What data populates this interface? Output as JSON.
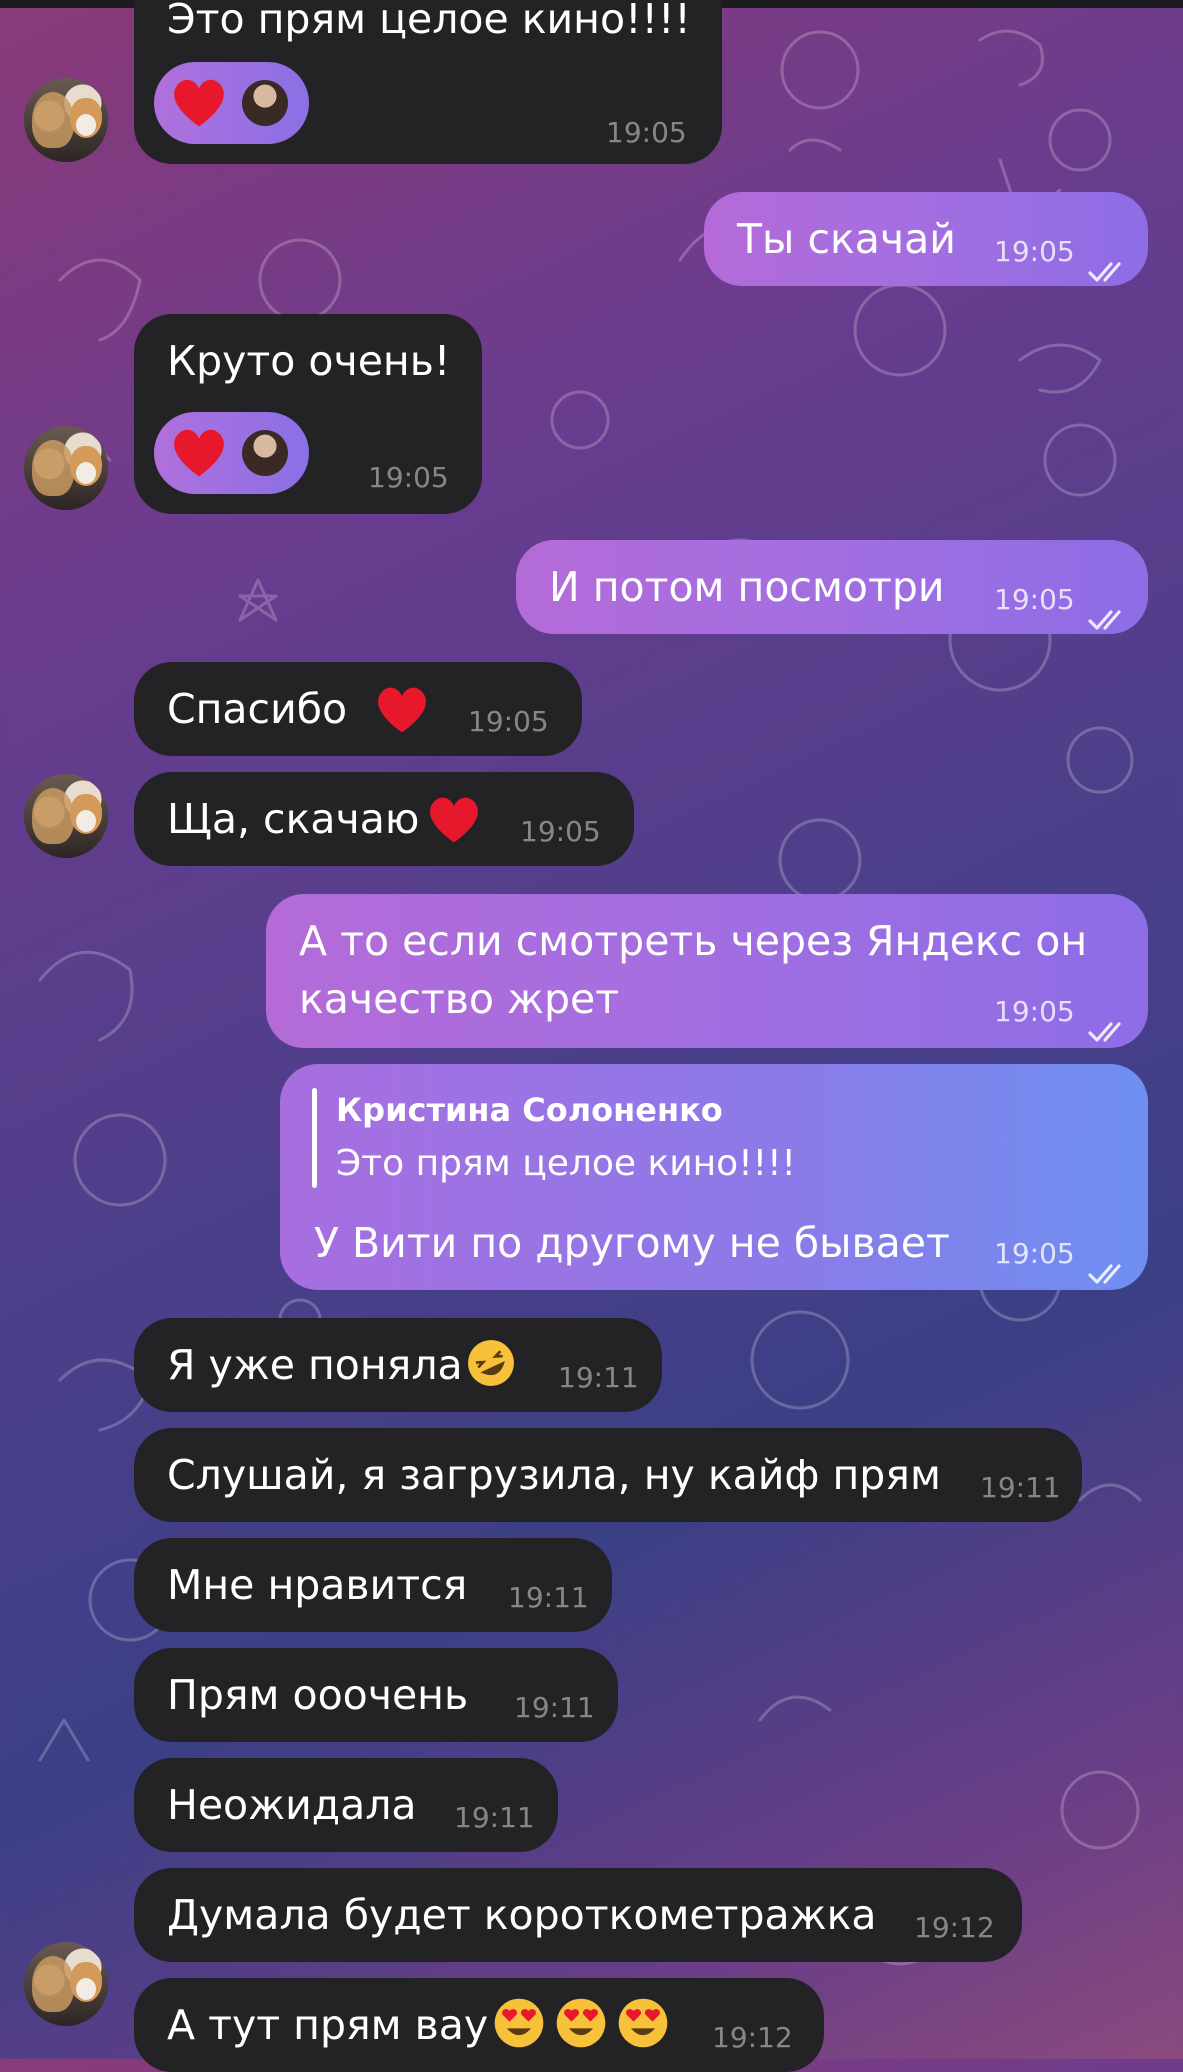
{
  "colors": {
    "incoming_bubble": "#232326",
    "outgoing_gradient_start": "#b46bd8",
    "outgoing_gradient_end": "#6e8ff0",
    "text": "#ffffff"
  },
  "messages": [
    {
      "direction": "in",
      "text": "Это прям целое кино!!!!",
      "time": "19:05",
      "reaction": "heart-reaction",
      "has_avatar": true
    },
    {
      "direction": "out",
      "text": "Ты скачай",
      "time": "19:05",
      "status": "read"
    },
    {
      "direction": "in",
      "text": "Круто очень!",
      "time": "19:05",
      "reaction": "heart-reaction",
      "has_avatar": true
    },
    {
      "direction": "out",
      "text": "И потом посмотри",
      "time": "19:05",
      "status": "read"
    },
    {
      "direction": "in",
      "text": "Спасибо",
      "time": "19:05",
      "emoji": "red-heart"
    },
    {
      "direction": "in",
      "text": "Ща, скачаю",
      "time": "19:05",
      "emoji": "red-heart",
      "has_avatar": true
    },
    {
      "direction": "out",
      "text_line1": "А то если смотреть через Яндекс он",
      "text_line2": "качество жрет",
      "time": "19:05",
      "status": "read"
    },
    {
      "direction": "out",
      "reply_to": {
        "name": "Кристина Солоненко",
        "text": "Это прям целое кино!!!!"
      },
      "text": "У Вити по другому не бывает",
      "time": "19:05",
      "status": "read"
    },
    {
      "direction": "in",
      "text": "Я уже поняла",
      "time": "19:11",
      "emoji": "rolling-laughing"
    },
    {
      "direction": "in",
      "text": "Слушай, я загрузила, ну кайф прям",
      "time": "19:11"
    },
    {
      "direction": "in",
      "text": "Мне нравится",
      "time": "19:11"
    },
    {
      "direction": "in",
      "text": "Прям ооочень",
      "time": "19:11"
    },
    {
      "direction": "in",
      "text": "Неожидала",
      "time": "19:11"
    },
    {
      "direction": "in",
      "text": "Думала будет короткометражка",
      "time": "19:12"
    },
    {
      "direction": "in",
      "text": "А тут прям вау",
      "time": "19:12",
      "emoji": "heart-eyes x3",
      "has_avatar": true
    }
  ]
}
